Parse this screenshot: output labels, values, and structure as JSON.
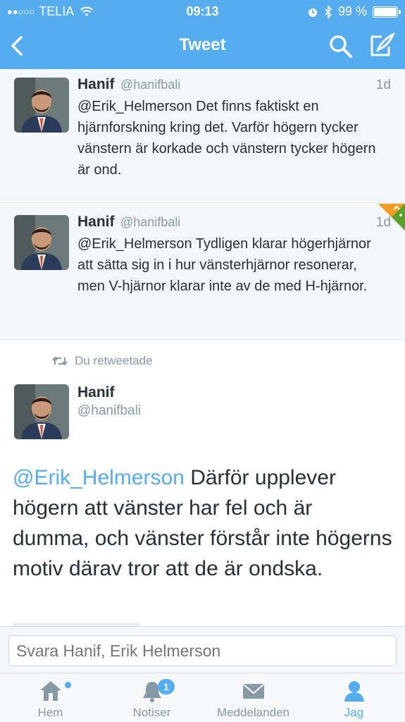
{
  "status_bar": {
    "carrier": "TELIA",
    "time": "09:13",
    "battery": "99 %",
    "battery_level": 0.99
  },
  "nav": {
    "title": "Tweet",
    "back_icon": "chevron-left-icon",
    "search_icon": "search-icon",
    "compose_icon": "compose-icon"
  },
  "tweets": [
    {
      "name": "Hanif",
      "handle": "@hanifbali",
      "age": "1d",
      "text": "@Erik_Helmerson Det finns faktiskt en hjärnforskning kring det. Varför högern tycker vänstern är korkade och vänstern tycker högern är ond."
    },
    {
      "name": "Hanif",
      "handle": "@hanifbali",
      "age": "1d",
      "text": "@Erik_Helmerson Tydligen klarar högerhjärnor att sätta sig in i hur vänsterhjärnor resonerar, men V-hjärnor klarar inte av de med H-hjärnor."
    }
  ],
  "retweet_label": "Du retweetade",
  "main_tweet": {
    "name": "Hanif",
    "handle": "@hanifbali",
    "mention": "@Erik_Helmerson",
    "text": " Därför upplever högern att vänster har fel och är dumma, och vänster förstår inte högerns motiv därav tror att de är ondska."
  },
  "reply": {
    "placeholder": "Svara Hanif, Erik Helmerson"
  },
  "tabs": [
    {
      "label": "Hem",
      "icon": "home-icon"
    },
    {
      "label": "Notiser",
      "icon": "bell-icon",
      "badge": "1"
    },
    {
      "label": "Meddelanden",
      "icon": "envelope-icon"
    },
    {
      "label": "Jag",
      "icon": "person-icon"
    }
  ],
  "colors": {
    "accent": "#55acee",
    "text": "#292f33",
    "muted": "#8899a6"
  }
}
